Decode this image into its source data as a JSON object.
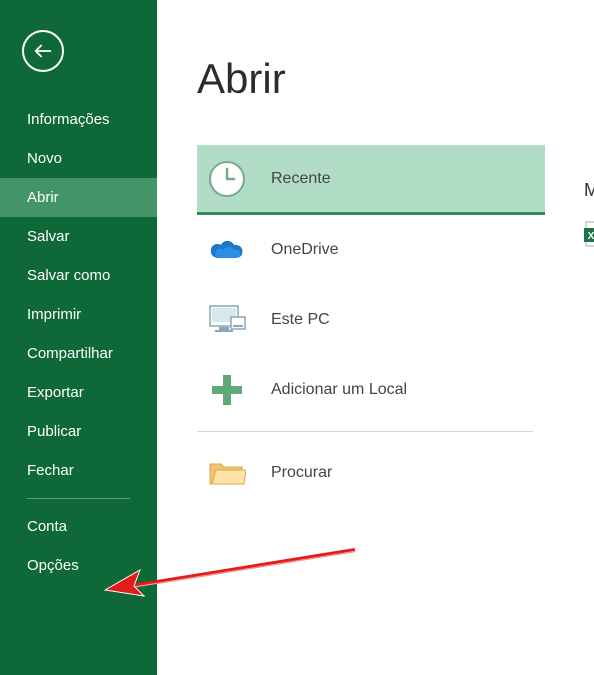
{
  "sidebar": {
    "items": [
      {
        "label": "Informações"
      },
      {
        "label": "Novo"
      },
      {
        "label": "Abrir"
      },
      {
        "label": "Salvar"
      },
      {
        "label": "Salvar como"
      },
      {
        "label": "Imprimir"
      },
      {
        "label": "Compartilhar"
      },
      {
        "label": "Exportar"
      },
      {
        "label": "Publicar"
      },
      {
        "label": "Fechar"
      }
    ],
    "bottom": [
      {
        "label": "Conta"
      },
      {
        "label": "Opções"
      }
    ]
  },
  "main": {
    "title": "Abrir",
    "locations": [
      {
        "label": "Recente"
      },
      {
        "label": "OneDrive"
      },
      {
        "label": "Este PC"
      },
      {
        "label": "Adicionar um Local"
      },
      {
        "label": "Procurar"
      }
    ]
  },
  "edge_letter": "M"
}
